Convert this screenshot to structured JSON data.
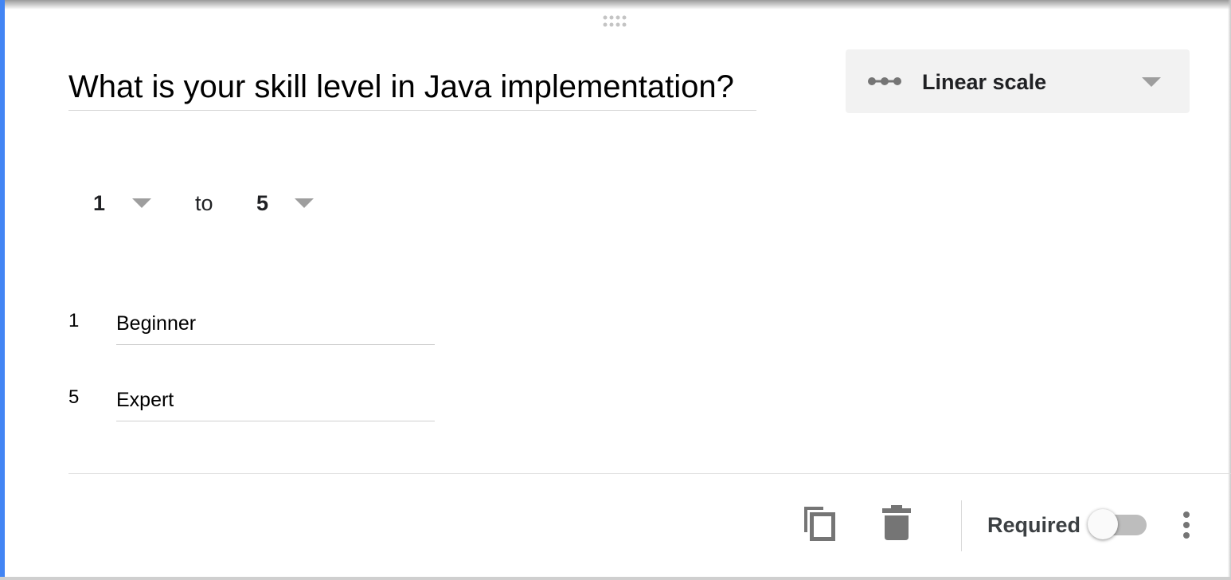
{
  "question": {
    "title": "What is your skill level in Java implementation?"
  },
  "question_type": {
    "label": "Linear scale",
    "icon": "linear-scale-icon"
  },
  "scale": {
    "min": "1",
    "separator": "to",
    "max": "5"
  },
  "scale_labels": [
    {
      "value": "1",
      "label": "Beginner"
    },
    {
      "value": "5",
      "label": "Expert"
    }
  ],
  "footer": {
    "copy_icon": "duplicate-icon",
    "delete_icon": "trash-icon",
    "required_label": "Required",
    "required_on": false,
    "more_icon": "more-vert-icon"
  },
  "colors": {
    "accent": "#4285f4",
    "icon_gray": "#757575",
    "select_bg": "#f2f2f2"
  }
}
